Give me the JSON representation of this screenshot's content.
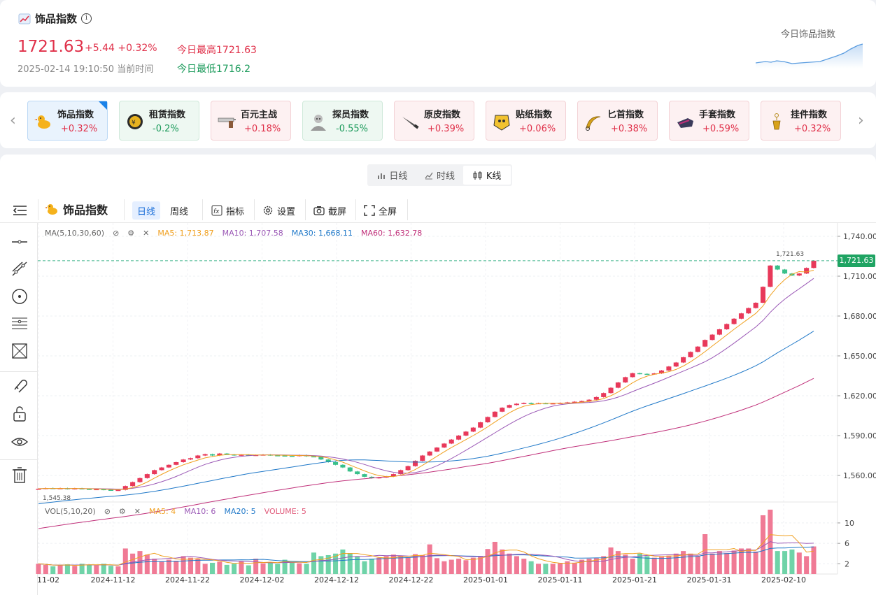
{
  "header": {
    "title": "饰品指数",
    "price": "1721.63",
    "change": "+5.44 +0.32%",
    "high_label": "今日最高1721.63",
    "timestamp": "2025-02-14 19:10:50 当前时间",
    "low_label": "今日最低1716.2",
    "spark_label": "今日饰品指数",
    "colors": {
      "up": "#e0314a",
      "down": "#1a9a5a"
    }
  },
  "index_tabs": [
    {
      "name": "饰品指数",
      "pct": "+0.32%",
      "dir": "active",
      "icon": "duck-icon"
    },
    {
      "name": "租赁指数",
      "pct": "-0.2%",
      "dir": "down",
      "icon": "rental-coin-icon"
    },
    {
      "name": "百元主战",
      "pct": "+0.18%",
      "dir": "up",
      "icon": "pistol-icon"
    },
    {
      "name": "探员指数",
      "pct": "-0.55%",
      "dir": "down",
      "icon": "agent-icon"
    },
    {
      "name": "原皮指数",
      "pct": "+0.39%",
      "dir": "up",
      "icon": "knife-icon"
    },
    {
      "name": "贴纸指数",
      "pct": "+0.06%",
      "dir": "up",
      "icon": "sticker-icon"
    },
    {
      "name": "匕首指数",
      "pct": "+0.38%",
      "dir": "up",
      "icon": "karambit-icon"
    },
    {
      "name": "手套指数",
      "pct": "+0.59%",
      "dir": "up",
      "icon": "glove-icon"
    },
    {
      "name": "挂件指数",
      "pct": "+0.32%",
      "dir": "up",
      "icon": "charm-icon"
    }
  ],
  "view_switch": {
    "daily": "日线",
    "time": "时线",
    "kline": "K线",
    "selected": "K线"
  },
  "toolbar": {
    "title": "饰品指数",
    "daily": "日线",
    "weekly": "周线",
    "indicators": "指标",
    "settings": "设置",
    "screenshot": "截屏",
    "fullscreen": "全屏"
  },
  "chart_legend": {
    "ma_label": "MA(5,10,30,60)",
    "ma5": "MA5: 1,713.87",
    "ma10": "MA10: 1,707.58",
    "ma30": "MA30: 1,668.11",
    "ma60": "MA60: 1,632.78",
    "vol_label": "VOL(5,10,20)",
    "vma5": "MA5: 4",
    "vma10": "MA10: 6",
    "vma20": "MA20: 5",
    "volume": "VOLUME: 5",
    "colors": {
      "ma5": "#f0a020",
      "ma10": "#9b59b6",
      "ma30": "#1f78c8",
      "ma60": "#c0307a"
    }
  },
  "chart_data": {
    "type": "candlestick",
    "price_axis": {
      "ticks": [
        "1,740.00",
        "1,710.00",
        "1,680.00",
        "1,650.00",
        "1,620.00",
        "1,590.00",
        "1,560.00"
      ],
      "ylim": [
        1540,
        1750
      ]
    },
    "volume_axis": {
      "ticks": [
        "10",
        "6",
        "2"
      ],
      "ylim": [
        0,
        13
      ]
    },
    "x_labels": [
      "11-02",
      "2024-11-12",
      "2024-11-22",
      "2024-12-02",
      "2024-12-12",
      "2024-12-22",
      "2025-01-01",
      "2025-01-11",
      "2025-01-21",
      "2025-01-31",
      "2025-02-10"
    ],
    "last_price_tag": "1,721.63",
    "max_label": "1,721.63",
    "min_label": "1,545.38",
    "closes": [
      1550,
      1550.5,
      1550.2,
      1550.4,
      1549.8,
      1550.3,
      1549.9,
      1549.5,
      1549.7,
      1549.2,
      1548.8,
      1549.1,
      1552,
      1555,
      1558,
      1561,
      1564,
      1566,
      1568,
      1570,
      1572,
      1573,
      1575,
      1576,
      1575,
      1576.5,
      1575.8,
      1575.2,
      1575.6,
      1575.1,
      1575.4,
      1575.7,
      1575.2,
      1575,
      1574.8,
      1574.6,
      1575.3,
      1574.4,
      1574.1,
      1572,
      1570,
      1568,
      1566,
      1563,
      1561,
      1559,
      1558,
      1558.6,
      1559.2,
      1561,
      1564,
      1567,
      1571,
      1575,
      1578,
      1581,
      1584,
      1587,
      1590,
      1593,
      1596,
      1600,
      1604,
      1608,
      1611,
      1613,
      1614,
      1614.5,
      1614.2,
      1614.4,
      1614.1,
      1614.3,
      1614.6,
      1615,
      1615.5,
      1616,
      1617,
      1619,
      1622,
      1626,
      1630,
      1634,
      1637,
      1636.5,
      1636.2,
      1636.8,
      1639,
      1642,
      1645,
      1649,
      1653,
      1657,
      1662,
      1666,
      1670,
      1674,
      1678,
      1682,
      1686,
      1690,
      1702,
      1718,
      1715,
      1712,
      1710.5,
      1712,
      1716.2,
      1721.63
    ],
    "volumes": [
      2,
      1.8,
      1.5,
      1.7,
      1.9,
      1.6,
      2,
      1.8,
      1.7,
      2,
      1.6,
      1.5,
      5,
      4,
      4.5,
      3.8,
      3,
      2.5,
      2.8,
      2.6,
      3.5,
      3.2,
      3,
      2,
      2.2,
      2.4,
      1.8,
      2,
      2.5,
      1.7,
      3,
      2.1,
      2.3,
      2,
      2.8,
      2.4,
      2.1,
      2,
      4.2,
      3.5,
      3.7,
      4,
      4.8,
      4.1,
      3.5,
      2.5,
      3,
      3.2,
      3.5,
      3.8,
      3.6,
      3.3,
      3.9,
      3.7,
      5.8,
      3.1,
      2.5,
      2.8,
      3,
      2.7,
      3.2,
      3.5,
      4.9,
      6.3,
      4.8,
      4,
      3.5,
      3,
      2.5,
      2,
      2,
      2,
      2.1,
      2.5,
      2.2,
      2.8,
      3,
      3.1,
      3.5,
      5.2,
      4.5,
      3.8,
      3,
      4,
      3.5,
      3.2,
      3.4,
      3.6,
      4,
      4.5,
      4,
      3.5,
      7.8,
      4,
      4.5,
      4.1,
      4.6,
      5,
      5,
      4.4,
      11.5,
      12.6,
      4.5,
      4.5,
      4.8,
      4.2,
      3.5,
      5.4
    ],
    "ma5": [],
    "ma10": [],
    "ma30": [],
    "ma60": []
  }
}
